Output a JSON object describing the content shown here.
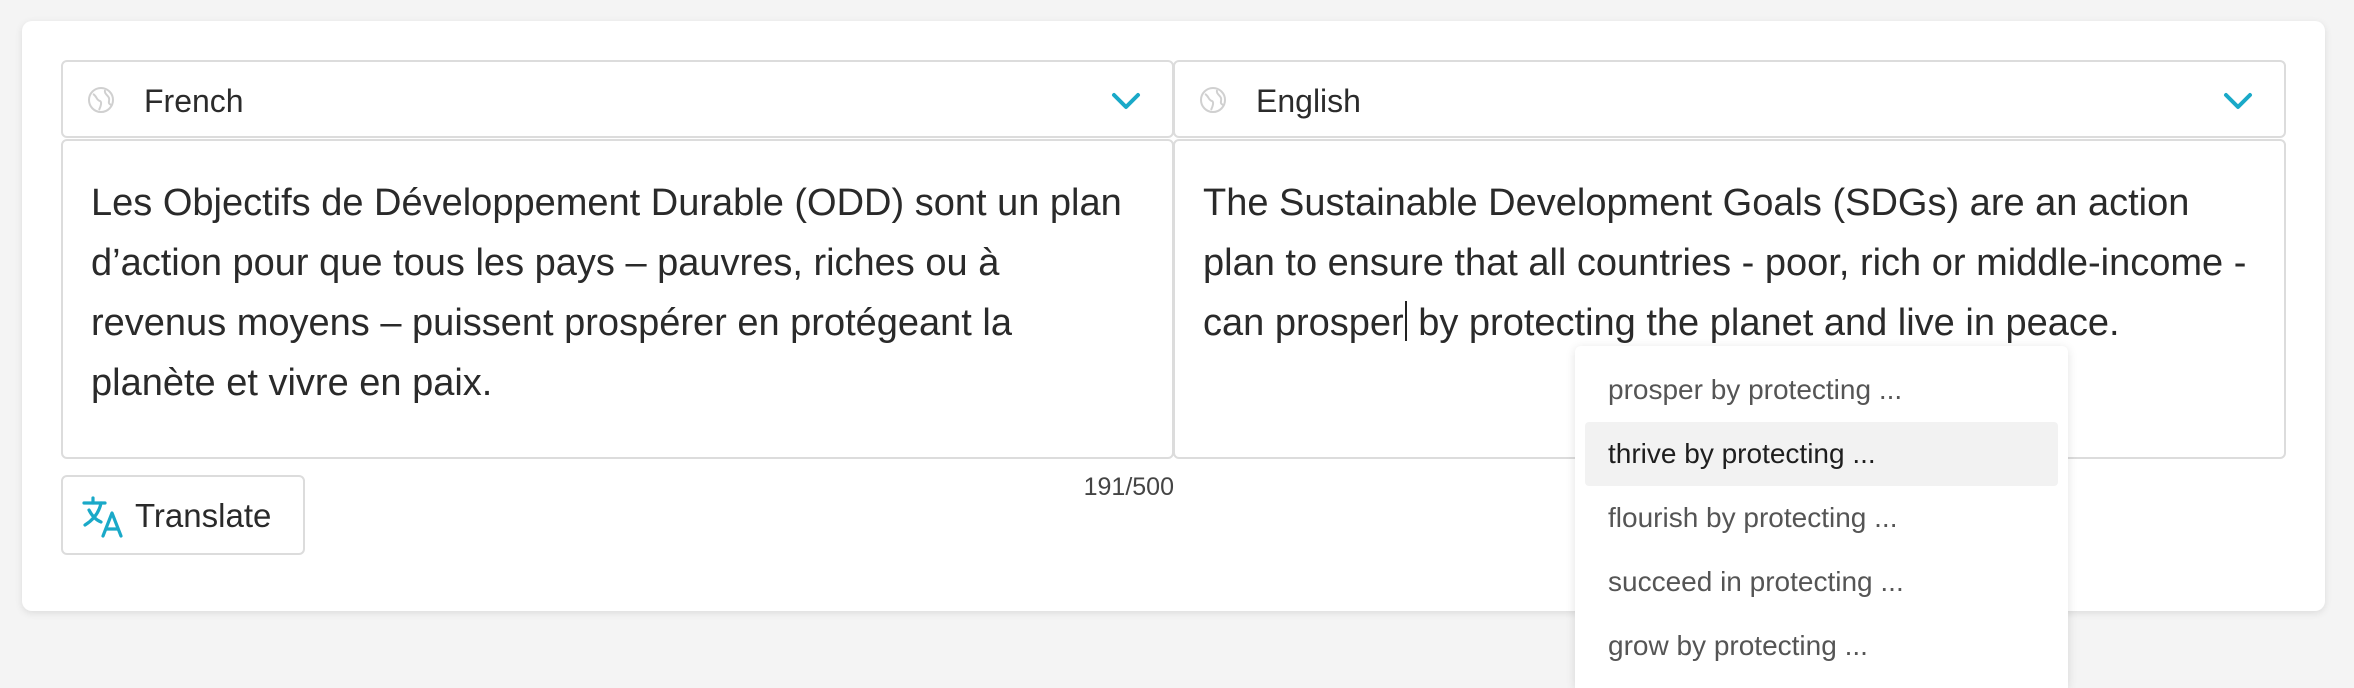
{
  "source": {
    "language": "French",
    "text": "Les Objectifs de Développement Durable (ODD) sont un plan d’action pour que tous les pays – pauvres, riches ou à revenus moyens – puissent prospérer en protégeant la planète et vivre en paix."
  },
  "target": {
    "language": "English",
    "text_before_cursor": "The Sustainable Development Goals (SDGs) are an action plan to ensure that all countries - poor, rich or middle-income - can prosper",
    "text_after_cursor": " by protecting the planet and live in peace."
  },
  "counter": "191/500",
  "translate_button": {
    "label": "Translate",
    "icon": "translate-icon"
  },
  "suggestions": [
    {
      "label": "prosper by protecting ..."
    },
    {
      "label": "thrive by protecting ..."
    },
    {
      "label": "flourish by protecting ..."
    },
    {
      "label": "succeed in protecting ..."
    },
    {
      "label": "grow by protecting ..."
    }
  ],
  "highlighted_suggestion_index": 1,
  "colors": {
    "accent": "#1aa9c8",
    "border": "#dcdcdc",
    "text": "#2a2a2a",
    "background": "#f4f4f4"
  }
}
